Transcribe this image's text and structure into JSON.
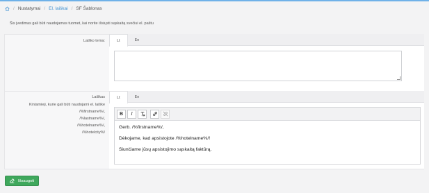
{
  "breadcrumb": {
    "sep": "/",
    "items": [
      "Nustatymai",
      "El. laiškai",
      "SF Šablonas"
    ]
  },
  "description": "Šis įvedimas gali būti naudojamas tuomet, kai norite išsiųsti sąskaitą svečiui el. paštu",
  "subject": {
    "label": "Laiško tema:",
    "tabs": [
      "Lt",
      "En"
    ],
    "value": ""
  },
  "body": {
    "label": "Laiškas",
    "variables_label": "Kintamieji, kurie gali būti naudojami el. laiške",
    "variables": [
      "/%firstname%/,",
      "/%lastname%/,",
      "/%hotelname%/,",
      "/%hotelcity%/"
    ],
    "tabs": [
      "Lt",
      "En"
    ],
    "toolbar": [
      "bold-icon",
      "italic-icon",
      "clear-format-icon",
      "link-icon",
      "unlink-icon"
    ],
    "toolbar_labels": {
      "bold": "B",
      "italic": "I"
    },
    "lines": [
      "Gerb.  /%firstname%/,",
      "Dėkojame, kad apsistojote /%hotelname%/!",
      "Siunčiame jūsų apsistojimo sąskaitą faktūrą."
    ]
  },
  "save_button": {
    "label": "Išsaugoti",
    "icon": "edit-icon"
  },
  "colors": {
    "accent": "#3c8fd0",
    "save": "#3fa85c"
  }
}
